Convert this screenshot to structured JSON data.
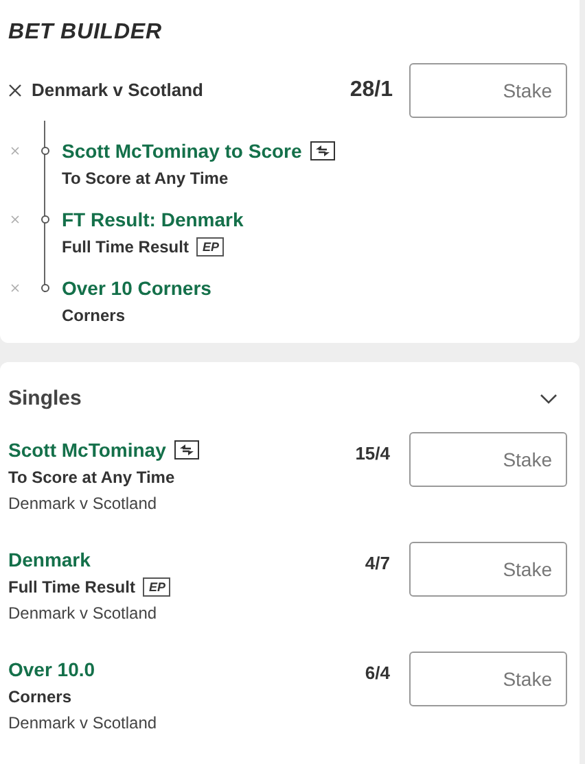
{
  "bet_builder": {
    "title": "BET BUILDER",
    "match": "Denmark v Scotland",
    "odds": "28/1",
    "stake": {
      "placeholder": "Stake"
    },
    "legs": [
      {
        "selection": "Scott McTominay to Score",
        "market": "To Score at Any Time",
        "selection_tag": {
          "kind": "swap"
        }
      },
      {
        "selection": "FT Result: Denmark",
        "market": "Full Time Result",
        "market_tag": {
          "kind": "text",
          "text": "EP"
        }
      },
      {
        "selection": "Over 10 Corners",
        "market": "Corners"
      }
    ]
  },
  "singles": {
    "title": "Singles",
    "expanded": true,
    "bets": [
      {
        "selection": "Scott McTominay",
        "market": "To Score at Any Time",
        "event": "Denmark v Scotland",
        "odds": "15/4",
        "stake": {
          "placeholder": "Stake"
        },
        "selection_tag": {
          "kind": "swap"
        }
      },
      {
        "selection": "Denmark",
        "market": "Full Time Result",
        "event": "Denmark v Scotland",
        "odds": "4/7",
        "stake": {
          "placeholder": "Stake"
        },
        "market_tag": {
          "kind": "text",
          "text": "EP"
        }
      },
      {
        "selection": "Over 10.0",
        "market": "Corners",
        "event": "Denmark v Scotland",
        "odds": "6/4",
        "stake": {
          "placeholder": "Stake"
        }
      }
    ]
  }
}
